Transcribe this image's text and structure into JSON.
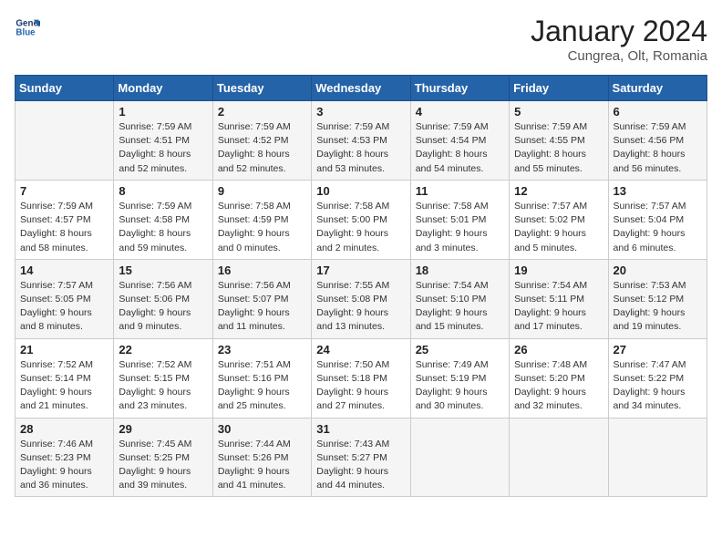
{
  "header": {
    "logo_line1": "General",
    "logo_line2": "Blue",
    "title": "January 2024",
    "subtitle": "Cungrea, Olt, Romania"
  },
  "weekdays": [
    "Sunday",
    "Monday",
    "Tuesday",
    "Wednesday",
    "Thursday",
    "Friday",
    "Saturday"
  ],
  "weeks": [
    [
      {
        "day": "",
        "sunrise": "",
        "sunset": "",
        "daylight": ""
      },
      {
        "day": "1",
        "sunrise": "Sunrise: 7:59 AM",
        "sunset": "Sunset: 4:51 PM",
        "daylight": "Daylight: 8 hours and 52 minutes."
      },
      {
        "day": "2",
        "sunrise": "Sunrise: 7:59 AM",
        "sunset": "Sunset: 4:52 PM",
        "daylight": "Daylight: 8 hours and 52 minutes."
      },
      {
        "day": "3",
        "sunrise": "Sunrise: 7:59 AM",
        "sunset": "Sunset: 4:53 PM",
        "daylight": "Daylight: 8 hours and 53 minutes."
      },
      {
        "day": "4",
        "sunrise": "Sunrise: 7:59 AM",
        "sunset": "Sunset: 4:54 PM",
        "daylight": "Daylight: 8 hours and 54 minutes."
      },
      {
        "day": "5",
        "sunrise": "Sunrise: 7:59 AM",
        "sunset": "Sunset: 4:55 PM",
        "daylight": "Daylight: 8 hours and 55 minutes."
      },
      {
        "day": "6",
        "sunrise": "Sunrise: 7:59 AM",
        "sunset": "Sunset: 4:56 PM",
        "daylight": "Daylight: 8 hours and 56 minutes."
      }
    ],
    [
      {
        "day": "7",
        "sunrise": "Sunrise: 7:59 AM",
        "sunset": "Sunset: 4:57 PM",
        "daylight": "Daylight: 8 hours and 58 minutes."
      },
      {
        "day": "8",
        "sunrise": "Sunrise: 7:59 AM",
        "sunset": "Sunset: 4:58 PM",
        "daylight": "Daylight: 8 hours and 59 minutes."
      },
      {
        "day": "9",
        "sunrise": "Sunrise: 7:58 AM",
        "sunset": "Sunset: 4:59 PM",
        "daylight": "Daylight: 9 hours and 0 minutes."
      },
      {
        "day": "10",
        "sunrise": "Sunrise: 7:58 AM",
        "sunset": "Sunset: 5:00 PM",
        "daylight": "Daylight: 9 hours and 2 minutes."
      },
      {
        "day": "11",
        "sunrise": "Sunrise: 7:58 AM",
        "sunset": "Sunset: 5:01 PM",
        "daylight": "Daylight: 9 hours and 3 minutes."
      },
      {
        "day": "12",
        "sunrise": "Sunrise: 7:57 AM",
        "sunset": "Sunset: 5:02 PM",
        "daylight": "Daylight: 9 hours and 5 minutes."
      },
      {
        "day": "13",
        "sunrise": "Sunrise: 7:57 AM",
        "sunset": "Sunset: 5:04 PM",
        "daylight": "Daylight: 9 hours and 6 minutes."
      }
    ],
    [
      {
        "day": "14",
        "sunrise": "Sunrise: 7:57 AM",
        "sunset": "Sunset: 5:05 PM",
        "daylight": "Daylight: 9 hours and 8 minutes."
      },
      {
        "day": "15",
        "sunrise": "Sunrise: 7:56 AM",
        "sunset": "Sunset: 5:06 PM",
        "daylight": "Daylight: 9 hours and 9 minutes."
      },
      {
        "day": "16",
        "sunrise": "Sunrise: 7:56 AM",
        "sunset": "Sunset: 5:07 PM",
        "daylight": "Daylight: 9 hours and 11 minutes."
      },
      {
        "day": "17",
        "sunrise": "Sunrise: 7:55 AM",
        "sunset": "Sunset: 5:08 PM",
        "daylight": "Daylight: 9 hours and 13 minutes."
      },
      {
        "day": "18",
        "sunrise": "Sunrise: 7:54 AM",
        "sunset": "Sunset: 5:10 PM",
        "daylight": "Daylight: 9 hours and 15 minutes."
      },
      {
        "day": "19",
        "sunrise": "Sunrise: 7:54 AM",
        "sunset": "Sunset: 5:11 PM",
        "daylight": "Daylight: 9 hours and 17 minutes."
      },
      {
        "day": "20",
        "sunrise": "Sunrise: 7:53 AM",
        "sunset": "Sunset: 5:12 PM",
        "daylight": "Daylight: 9 hours and 19 minutes."
      }
    ],
    [
      {
        "day": "21",
        "sunrise": "Sunrise: 7:52 AM",
        "sunset": "Sunset: 5:14 PM",
        "daylight": "Daylight: 9 hours and 21 minutes."
      },
      {
        "day": "22",
        "sunrise": "Sunrise: 7:52 AM",
        "sunset": "Sunset: 5:15 PM",
        "daylight": "Daylight: 9 hours and 23 minutes."
      },
      {
        "day": "23",
        "sunrise": "Sunrise: 7:51 AM",
        "sunset": "Sunset: 5:16 PM",
        "daylight": "Daylight: 9 hours and 25 minutes."
      },
      {
        "day": "24",
        "sunrise": "Sunrise: 7:50 AM",
        "sunset": "Sunset: 5:18 PM",
        "daylight": "Daylight: 9 hours and 27 minutes."
      },
      {
        "day": "25",
        "sunrise": "Sunrise: 7:49 AM",
        "sunset": "Sunset: 5:19 PM",
        "daylight": "Daylight: 9 hours and 30 minutes."
      },
      {
        "day": "26",
        "sunrise": "Sunrise: 7:48 AM",
        "sunset": "Sunset: 5:20 PM",
        "daylight": "Daylight: 9 hours and 32 minutes."
      },
      {
        "day": "27",
        "sunrise": "Sunrise: 7:47 AM",
        "sunset": "Sunset: 5:22 PM",
        "daylight": "Daylight: 9 hours and 34 minutes."
      }
    ],
    [
      {
        "day": "28",
        "sunrise": "Sunrise: 7:46 AM",
        "sunset": "Sunset: 5:23 PM",
        "daylight": "Daylight: 9 hours and 36 minutes."
      },
      {
        "day": "29",
        "sunrise": "Sunrise: 7:45 AM",
        "sunset": "Sunset: 5:25 PM",
        "daylight": "Daylight: 9 hours and 39 minutes."
      },
      {
        "day": "30",
        "sunrise": "Sunrise: 7:44 AM",
        "sunset": "Sunset: 5:26 PM",
        "daylight": "Daylight: 9 hours and 41 minutes."
      },
      {
        "day": "31",
        "sunrise": "Sunrise: 7:43 AM",
        "sunset": "Sunset: 5:27 PM",
        "daylight": "Daylight: 9 hours and 44 minutes."
      },
      {
        "day": "",
        "sunrise": "",
        "sunset": "",
        "daylight": ""
      },
      {
        "day": "",
        "sunrise": "",
        "sunset": "",
        "daylight": ""
      },
      {
        "day": "",
        "sunrise": "",
        "sunset": "",
        "daylight": ""
      }
    ]
  ]
}
